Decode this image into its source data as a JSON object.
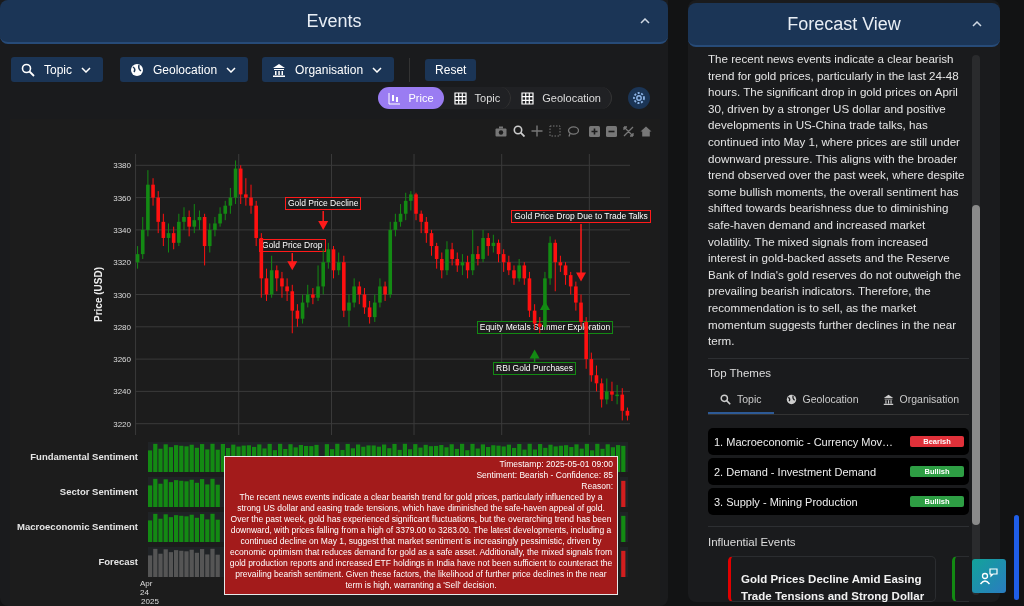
{
  "events_panel": {
    "title": "Events",
    "filters": [
      {
        "label": "Topic",
        "kind": "topic"
      },
      {
        "label": "Geolocation",
        "kind": "geo"
      },
      {
        "label": "Organisation",
        "kind": "org"
      }
    ],
    "reset_button": "Reset",
    "view_toggle": [
      {
        "label": "Price",
        "kind": "price",
        "selected": true
      },
      {
        "label": "Topic",
        "kind": "grid",
        "selected": false
      },
      {
        "label": "Geolocation",
        "kind": "grid",
        "selected": false
      }
    ],
    "price_chart": {
      "annotation_marks": [
        {
          "color": "#ff1a1a"
        },
        {
          "color": "#ff1a1a"
        },
        {
          "color": "#ff1a1a"
        },
        {
          "color": "#138a13"
        },
        {
          "color": "#138a13"
        }
      ],
      "chart_data": {
        "type": "candlestick",
        "ylabel": "Price (USD)",
        "ylim": [
          3213,
          3387
        ],
        "yticks": [
          3220,
          3240,
          3260,
          3280,
          3300,
          3320,
          3340,
          3360,
          3380
        ],
        "grid": true,
        "ohlc": [
          [
            3320,
            3330,
            3316,
            3325
          ],
          [
            3325,
            3348,
            3322,
            3340
          ],
          [
            3340,
            3377,
            3336,
            3368
          ],
          [
            3368,
            3372,
            3355,
            3360
          ],
          [
            3360,
            3364,
            3338,
            3345
          ],
          [
            3345,
            3350,
            3330,
            3335
          ],
          [
            3335,
            3344,
            3326,
            3338
          ],
          [
            3338,
            3342,
            3328,
            3332
          ],
          [
            3332,
            3350,
            3330,
            3345
          ],
          [
            3345,
            3354,
            3340,
            3348
          ],
          [
            3348,
            3352,
            3336,
            3342
          ],
          [
            3342,
            3356,
            3338,
            3346
          ],
          [
            3346,
            3352,
            3340,
            3348
          ],
          [
            3348,
            3350,
            3318,
            3330
          ],
          [
            3330,
            3344,
            3326,
            3340
          ],
          [
            3340,
            3348,
            3336,
            3344
          ],
          [
            3344,
            3354,
            3342,
            3350
          ],
          [
            3350,
            3358,
            3346,
            3355
          ],
          [
            3355,
            3366,
            3350,
            3360
          ],
          [
            3360,
            3383,
            3356,
            3378
          ],
          [
            3378,
            3380,
            3356,
            3362
          ],
          [
            3362,
            3372,
            3355,
            3360
          ],
          [
            3360,
            3368,
            3350,
            3355
          ],
          [
            3355,
            3358,
            3330,
            3335
          ],
          [
            3335,
            3338,
            3298,
            3310
          ],
          [
            3310,
            3316,
            3296,
            3300
          ],
          [
            3300,
            3324,
            3298,
            3315
          ],
          [
            3315,
            3318,
            3302,
            3310
          ],
          [
            3310,
            3314,
            3298,
            3305
          ],
          [
            3305,
            3310,
            3296,
            3302
          ],
          [
            3302,
            3306,
            3276,
            3290
          ],
          [
            3290,
            3294,
            3280,
            3285
          ],
          [
            3285,
            3300,
            3282,
            3295
          ],
          [
            3295,
            3306,
            3292,
            3300
          ],
          [
            3300,
            3304,
            3294,
            3298
          ],
          [
            3298,
            3318,
            3296,
            3305
          ],
          [
            3305,
            3328,
            3300,
            3320
          ],
          [
            3320,
            3332,
            3316,
            3328
          ],
          [
            3328,
            3330,
            3310,
            3315
          ],
          [
            3315,
            3326,
            3312,
            3320
          ],
          [
            3320,
            3324,
            3286,
            3290
          ],
          [
            3290,
            3300,
            3280,
            3295
          ],
          [
            3295,
            3310,
            3292,
            3305
          ],
          [
            3305,
            3308,
            3294,
            3300
          ],
          [
            3300,
            3304,
            3288,
            3292
          ],
          [
            3292,
            3296,
            3282,
            3286
          ],
          [
            3286,
            3300,
            3283,
            3295
          ],
          [
            3295,
            3310,
            3292,
            3305
          ],
          [
            3305,
            3308,
            3296,
            3300
          ],
          [
            3300,
            3345,
            3298,
            3340
          ],
          [
            3340,
            3350,
            3336,
            3345
          ],
          [
            3345,
            3356,
            3342,
            3350
          ],
          [
            3350,
            3363,
            3346,
            3358
          ],
          [
            3358,
            3364,
            3352,
            3362
          ],
          [
            3362,
            3363,
            3346,
            3350
          ],
          [
            3350,
            3352,
            3338,
            3345
          ],
          [
            3345,
            3348,
            3332,
            3338
          ],
          [
            3338,
            3340,
            3324,
            3330
          ],
          [
            3330,
            3332,
            3316,
            3322
          ],
          [
            3322,
            3326,
            3310,
            3315
          ],
          [
            3315,
            3333,
            3312,
            3328
          ],
          [
            3328,
            3332,
            3318,
            3322
          ],
          [
            3322,
            3326,
            3314,
            3318
          ],
          [
            3318,
            3325,
            3312,
            3320
          ],
          [
            3320,
            3324,
            3310,
            3315
          ],
          [
            3315,
            3340,
            3312,
            3325
          ],
          [
            3325,
            3330,
            3318,
            3322
          ],
          [
            3322,
            3340,
            3320,
            3335
          ],
          [
            3335,
            3338,
            3324,
            3330
          ],
          [
            3330,
            3337,
            3326,
            3332
          ],
          [
            3332,
            3334,
            3320,
            3325
          ],
          [
            3325,
            3328,
            3314,
            3320
          ],
          [
            3320,
            3324,
            3312,
            3315
          ],
          [
            3315,
            3318,
            3306,
            3310
          ],
          [
            3310,
            3322,
            3308,
            3318
          ],
          [
            3318,
            3320,
            3306,
            3310
          ],
          [
            3310,
            3314,
            3286,
            3290
          ],
          [
            3290,
            3294,
            3278,
            3282
          ],
          [
            3282,
            3286,
            3276,
            3280
          ],
          [
            3280,
            3314,
            3278,
            3310
          ],
          [
            3310,
            3336,
            3306,
            3332
          ],
          [
            3332,
            3334,
            3302,
            3320
          ],
          [
            3320,
            3324,
            3314,
            3318
          ],
          [
            3318,
            3320,
            3306,
            3312
          ],
          [
            3312,
            3314,
            3300,
            3305
          ],
          [
            3305,
            3308,
            3290,
            3295
          ],
          [
            3295,
            3300,
            3280,
            3283
          ],
          [
            3283,
            3286,
            3254,
            3260
          ],
          [
            3260,
            3264,
            3246,
            3250
          ],
          [
            3250,
            3256,
            3240,
            3245
          ],
          [
            3245,
            3248,
            3230,
            3235
          ],
          [
            3235,
            3248,
            3232,
            3240
          ],
          [
            3240,
            3246,
            3234,
            3238
          ],
          [
            3238,
            3244,
            3232,
            3238
          ],
          [
            3238,
            3242,
            3222,
            3228
          ],
          [
            3228,
            3230,
            3222,
            3225
          ]
        ],
        "annotations": [
          "Gold Price Drop",
          "Gold Price Decline",
          "Gold Price Drop Due to Trade Talks",
          "Equity Metals Summer Exploration",
          "RBI Gold Purchases"
        ]
      }
    },
    "sentiment_rows": [
      {
        "label": "Fundamental Sentiment",
        "kind": "fundamental"
      },
      {
        "label": "Sector Sentiment",
        "kind": "sector"
      },
      {
        "label": "Macroeconomic Sentiment",
        "kind": "macro"
      },
      {
        "label": "Forecast",
        "kind": "forecast"
      }
    ],
    "time_axis": {
      "tick": "Apr 24",
      "year": "2025"
    },
    "tooltip": {
      "lines": [
        "Timestamp: 2025-05-01 09:00",
        "Sentiment: Bearish - Confidence: 85",
        "Reason:"
      ],
      "reason": "The recent news events indicate a clear bearish trend for gold prices, particularly influenced by a strong US dollar and easing trade tensions, which have diminished the safe-haven appeal of gold. Over the past week, gold has experienced significant fluctuations, but the overarching trend has been downward, with prices falling from a high of 3379.00 to 3283.00. The latest developments, including a continued decline on May 1, suggest that market sentiment is increasingly pessimistic, driven by economic optimism that reduces demand for gold as a safe asset. Additionally, the mixed signals from gold production reports and increased ETF holdings in India have not been sufficient to counteract the prevailing bearish sentiment. Given these factors, the likelihood of further price declines in the near term is high, warranting a 'Sell' decision."
    }
  },
  "forecast_panel": {
    "title": "Forecast View",
    "summary": "The recent news events indicate a clear bearish trend for gold prices, particularly in the last 24-48 hours. The significant drop in gold prices on April 30, driven by a stronger US dollar and positive developments in US-China trade talks, has continued into May 1, where prices are still under downward pressure. This aligns with the broader trend observed over the past week, where despite some bullish moments, the overall sentiment has shifted towards bearishness due to diminishing safe-haven demand and increased market volatility. The mixed signals from increased interest in gold-backed assets and the Reserve Bank of India's gold reserves do not outweigh the prevailing bearish indicators. Therefore, the recommendation is to sell, as the market momentum suggests further declines in the near term.",
    "themes_heading": "Top Themes",
    "theme_tabs": [
      {
        "label": "Topic",
        "kind": "topic",
        "selected": true
      },
      {
        "label": "Geolocation",
        "kind": "geo",
        "selected": false
      },
      {
        "label": "Organisation",
        "kind": "org",
        "selected": false
      }
    ],
    "themes": [
      {
        "label": "1. Macroeconomic - Currency Mov…",
        "sentiment": "Bearish",
        "color": "#e0313a"
      },
      {
        "label": "2. Demand - Investment Demand",
        "sentiment": "Bullish",
        "color": "#2e9e44"
      },
      {
        "label": "3. Supply - Mining Production",
        "sentiment": "Bullish",
        "color": "#2e9e44"
      }
    ],
    "events_heading": "Influential Events",
    "event_cards": [
      {
        "title": "Gold Prices Decline Amid Easing Trade Tensions and Strong Dollar",
        "color": "#e00000"
      },
      {
        "color": "#138a13"
      }
    ]
  }
}
